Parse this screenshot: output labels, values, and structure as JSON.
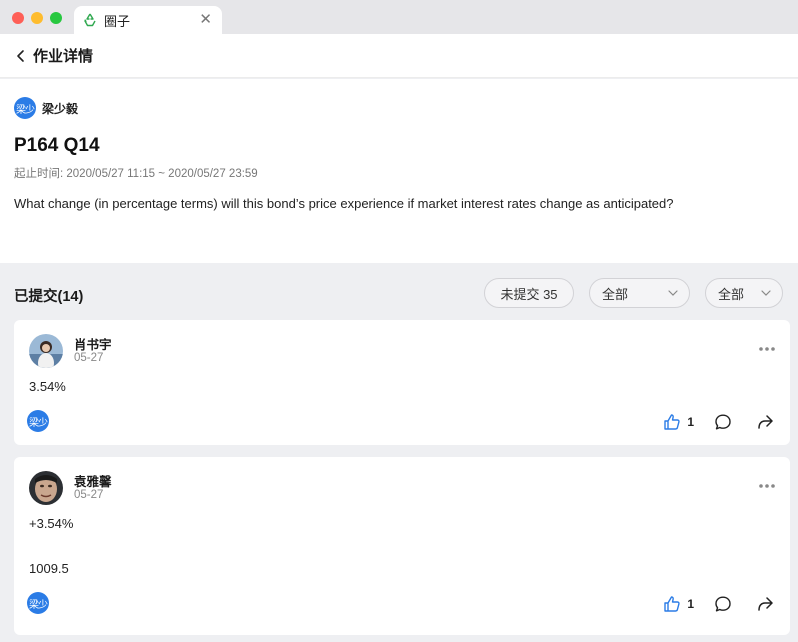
{
  "window": {
    "tab_title": "圈子",
    "tab_icon": "recycle-icon",
    "close_symbol": "✕"
  },
  "header": {
    "title": "作业详情"
  },
  "assignment": {
    "author_badge": "梁少",
    "author_name": "梁少毅",
    "title": "P164 Q14",
    "deadline": "起止时间: 2020/05/27 11:15 ~ 2020/05/27 23:59",
    "question": "What change (in percentage terms) will this bond’s price experience if market interest rates change as anticipated?"
  },
  "submissions": {
    "title": "已提交(14)",
    "unsubmitted_label": "未提交 35",
    "filter1": "全部",
    "filter2": "全部"
  },
  "cards": [
    {
      "name": "肖书宇",
      "date": "05-27",
      "answer_lines": [
        "3.54%"
      ],
      "badge": "梁少",
      "likes": "1"
    },
    {
      "name": "袁雅馨",
      "date": "05-27",
      "answer_lines": [
        "+3.54%",
        "1009.5"
      ],
      "badge": "梁少",
      "likes": "1"
    }
  ],
  "colors": {
    "accent": "#2b7ce6",
    "like": "#2b7ce6",
    "background": "#eeeff2"
  }
}
